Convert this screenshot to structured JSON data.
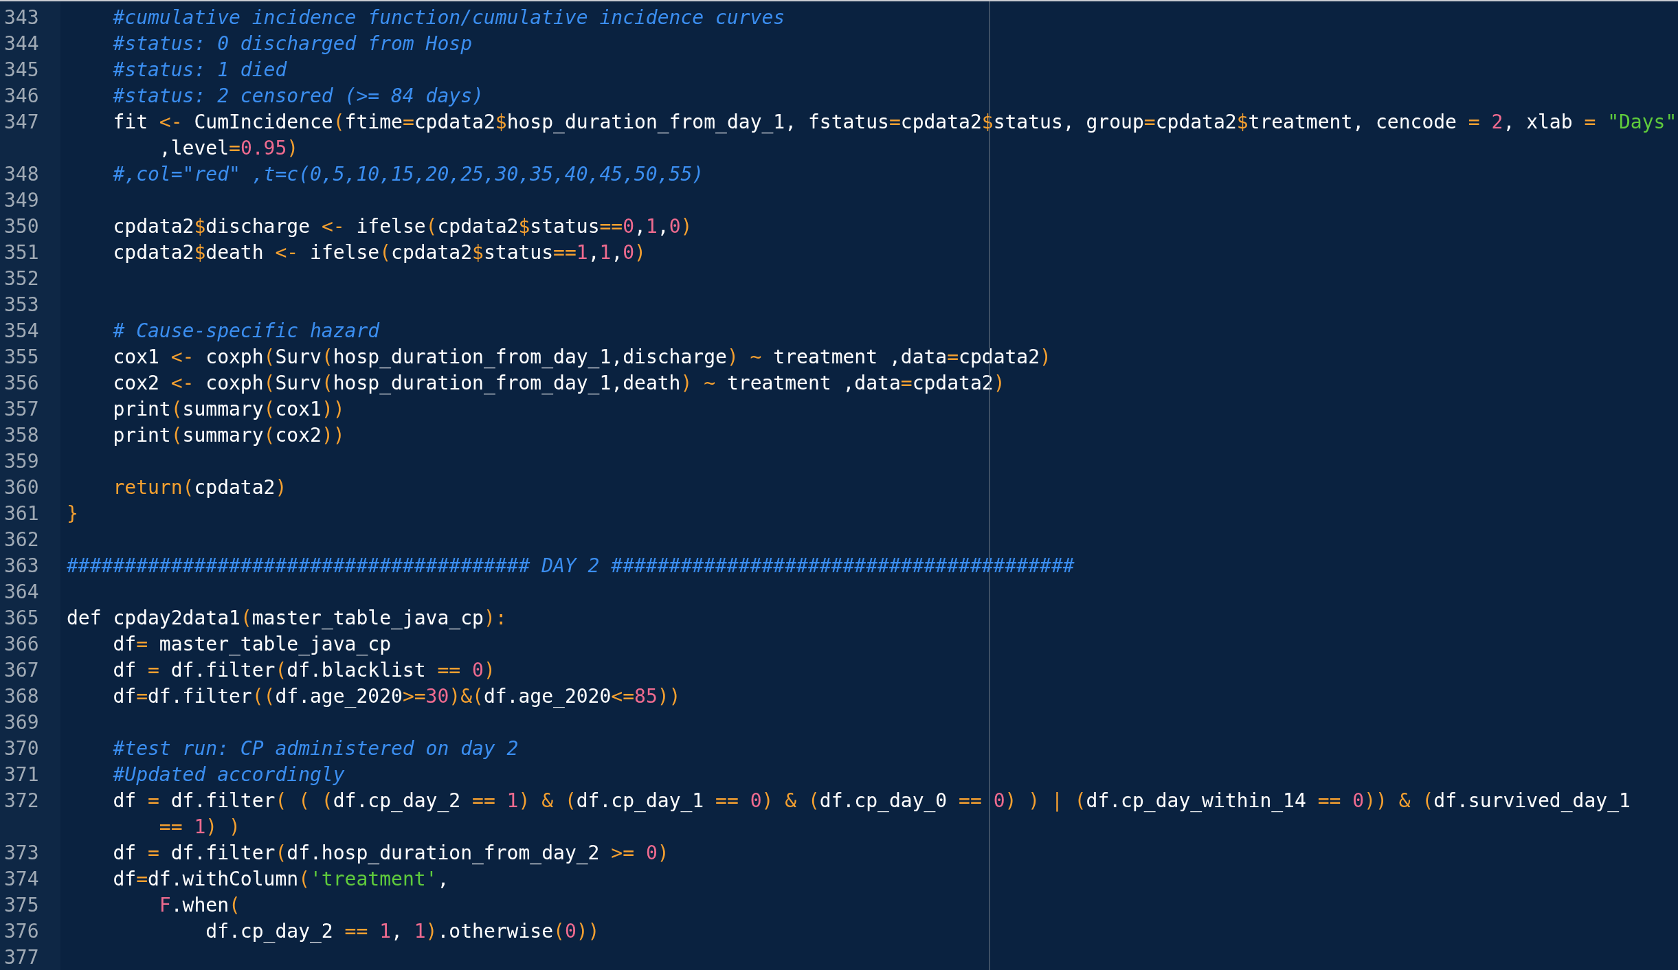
{
  "editor": {
    "lines": [
      {
        "number": "343",
        "segments": [
          {
            "kind": "comment",
            "text": "    #cumulative incidence function/cumulative incidence curves"
          }
        ]
      },
      {
        "number": "344",
        "segments": [
          {
            "kind": "comment",
            "text": "    #status: 0 discharged from Hosp"
          }
        ]
      },
      {
        "number": "345",
        "segments": [
          {
            "kind": "comment",
            "text": "    #status: 1 died"
          }
        ]
      },
      {
        "number": "346",
        "segments": [
          {
            "kind": "comment",
            "text": "    #status: 2 censored (>= 84 days)"
          }
        ]
      },
      {
        "number": "347",
        "segments": [
          {
            "kind": "plain",
            "text": "    fit "
          },
          {
            "kind": "op",
            "text": "<-"
          },
          {
            "kind": "plain",
            "text": " CumIncidence"
          },
          {
            "kind": "op",
            "text": "("
          },
          {
            "kind": "plain",
            "text": "ftime"
          },
          {
            "kind": "op",
            "text": "="
          },
          {
            "kind": "plain",
            "text": "cpdata2"
          },
          {
            "kind": "op",
            "text": "$"
          },
          {
            "kind": "plain",
            "text": "hosp_duration_from_day_1, fstatus"
          },
          {
            "kind": "op",
            "text": "="
          },
          {
            "kind": "plain",
            "text": "cpdata2"
          },
          {
            "kind": "op",
            "text": "$"
          },
          {
            "kind": "plain",
            "text": "status, group"
          },
          {
            "kind": "op",
            "text": "="
          },
          {
            "kind": "plain",
            "text": "cpdata2"
          },
          {
            "kind": "op",
            "text": "$"
          },
          {
            "kind": "plain",
            "text": "treatment, cencode "
          },
          {
            "kind": "op",
            "text": "= "
          },
          {
            "kind": "num",
            "text": "2"
          },
          {
            "kind": "plain",
            "text": ", xlab "
          },
          {
            "kind": "op",
            "text": "= "
          },
          {
            "kind": "str",
            "text": "\"Days\""
          }
        ],
        "wrap": [
          {
            "kind": "plain",
            "text": ",level"
          },
          {
            "kind": "op",
            "text": "="
          },
          {
            "kind": "num",
            "text": "0.95"
          },
          {
            "kind": "op",
            "text": ")"
          }
        ]
      },
      {
        "number": "348",
        "segments": [
          {
            "kind": "comment",
            "text": "    #,col=\"red\" ,t=c(0,5,10,15,20,25,30,35,40,45,50,55)"
          }
        ]
      },
      {
        "number": "349"
      },
      {
        "number": "350",
        "segments": [
          {
            "kind": "plain",
            "text": "    cpdata2"
          },
          {
            "kind": "op",
            "text": "$"
          },
          {
            "kind": "plain",
            "text": "discharge "
          },
          {
            "kind": "op",
            "text": "<-"
          },
          {
            "kind": "plain",
            "text": " ifelse"
          },
          {
            "kind": "op",
            "text": "("
          },
          {
            "kind": "plain",
            "text": "cpdata2"
          },
          {
            "kind": "op",
            "text": "$"
          },
          {
            "kind": "plain",
            "text": "status"
          },
          {
            "kind": "op",
            "text": "=="
          },
          {
            "kind": "num",
            "text": "0"
          },
          {
            "kind": "plain",
            "text": ","
          },
          {
            "kind": "num",
            "text": "1"
          },
          {
            "kind": "plain",
            "text": ","
          },
          {
            "kind": "num",
            "text": "0"
          },
          {
            "kind": "op",
            "text": ")"
          }
        ]
      },
      {
        "number": "351",
        "segments": [
          {
            "kind": "plain",
            "text": "    cpdata2"
          },
          {
            "kind": "op",
            "text": "$"
          },
          {
            "kind": "plain",
            "text": "death "
          },
          {
            "kind": "op",
            "text": "<-"
          },
          {
            "kind": "plain",
            "text": " ifelse"
          },
          {
            "kind": "op",
            "text": "("
          },
          {
            "kind": "plain",
            "text": "cpdata2"
          },
          {
            "kind": "op",
            "text": "$"
          },
          {
            "kind": "plain",
            "text": "status"
          },
          {
            "kind": "op",
            "text": "=="
          },
          {
            "kind": "num",
            "text": "1"
          },
          {
            "kind": "plain",
            "text": ","
          },
          {
            "kind": "num",
            "text": "1"
          },
          {
            "kind": "plain",
            "text": ","
          },
          {
            "kind": "num",
            "text": "0"
          },
          {
            "kind": "op",
            "text": ")"
          }
        ]
      },
      {
        "number": "352"
      },
      {
        "number": "353"
      },
      {
        "number": "354",
        "segments": [
          {
            "kind": "comment",
            "text": "    # Cause-specific hazard"
          }
        ]
      },
      {
        "number": "355",
        "segments": [
          {
            "kind": "plain",
            "text": "    cox1 "
          },
          {
            "kind": "op",
            "text": "<-"
          },
          {
            "kind": "plain",
            "text": " coxph"
          },
          {
            "kind": "op",
            "text": "("
          },
          {
            "kind": "plain",
            "text": "Surv"
          },
          {
            "kind": "op",
            "text": "("
          },
          {
            "kind": "plain",
            "text": "hosp_duration_from_day_1,discharge"
          },
          {
            "kind": "op",
            "text": ") ~"
          },
          {
            "kind": "plain",
            "text": " treatment ,data"
          },
          {
            "kind": "op",
            "text": "="
          },
          {
            "kind": "plain",
            "text": "cpdata2"
          },
          {
            "kind": "op",
            "text": ")"
          }
        ]
      },
      {
        "number": "356",
        "segments": [
          {
            "kind": "plain",
            "text": "    cox2 "
          },
          {
            "kind": "op",
            "text": "<-"
          },
          {
            "kind": "plain",
            "text": " coxph"
          },
          {
            "kind": "op",
            "text": "("
          },
          {
            "kind": "plain",
            "text": "Surv"
          },
          {
            "kind": "op",
            "text": "("
          },
          {
            "kind": "plain",
            "text": "hosp_duration_from_day_1,death"
          },
          {
            "kind": "op",
            "text": ") ~"
          },
          {
            "kind": "plain",
            "text": " treatment ,data"
          },
          {
            "kind": "op",
            "text": "="
          },
          {
            "kind": "plain",
            "text": "cpdata2"
          },
          {
            "kind": "op",
            "text": ")"
          }
        ]
      },
      {
        "number": "357",
        "segments": [
          {
            "kind": "plain",
            "text": "    print"
          },
          {
            "kind": "op",
            "text": "("
          },
          {
            "kind": "plain",
            "text": "summary"
          },
          {
            "kind": "op",
            "text": "("
          },
          {
            "kind": "plain",
            "text": "cox1"
          },
          {
            "kind": "op",
            "text": "))"
          }
        ]
      },
      {
        "number": "358",
        "segments": [
          {
            "kind": "plain",
            "text": "    print"
          },
          {
            "kind": "op",
            "text": "("
          },
          {
            "kind": "plain",
            "text": "summary"
          },
          {
            "kind": "op",
            "text": "("
          },
          {
            "kind": "plain",
            "text": "cox2"
          },
          {
            "kind": "op",
            "text": "))"
          }
        ]
      },
      {
        "number": "359"
      },
      {
        "number": "360",
        "segments": [
          {
            "kind": "op",
            "text": "    return("
          },
          {
            "kind": "plain",
            "text": "cpdata2"
          },
          {
            "kind": "op",
            "text": ")"
          }
        ]
      },
      {
        "number": "361",
        "segments": [
          {
            "kind": "op",
            "text": "}"
          }
        ]
      },
      {
        "number": "362"
      },
      {
        "number": "363",
        "segments": [
          {
            "kind": "comment",
            "text": "######################################## DAY 2 ########################################"
          }
        ]
      },
      {
        "number": "364"
      },
      {
        "number": "365",
        "segments": [
          {
            "kind": "plain",
            "text": "def cpday2data1"
          },
          {
            "kind": "op",
            "text": "("
          },
          {
            "kind": "plain",
            "text": "master_table_java_cp"
          },
          {
            "kind": "op",
            "text": "):"
          }
        ]
      },
      {
        "number": "366",
        "segments": [
          {
            "kind": "plain",
            "text": "    df"
          },
          {
            "kind": "op",
            "text": "="
          },
          {
            "kind": "plain",
            "text": " master_table_java_cp"
          }
        ]
      },
      {
        "number": "367",
        "segments": [
          {
            "kind": "plain",
            "text": "    df "
          },
          {
            "kind": "op",
            "text": "="
          },
          {
            "kind": "plain",
            "text": " df.filter"
          },
          {
            "kind": "op",
            "text": "("
          },
          {
            "kind": "plain",
            "text": "df.blacklist "
          },
          {
            "kind": "op",
            "text": "== "
          },
          {
            "kind": "num",
            "text": "0"
          },
          {
            "kind": "op",
            "text": ")"
          }
        ]
      },
      {
        "number": "368",
        "segments": [
          {
            "kind": "plain",
            "text": "    df"
          },
          {
            "kind": "op",
            "text": "="
          },
          {
            "kind": "plain",
            "text": "df.filter"
          },
          {
            "kind": "op",
            "text": "(("
          },
          {
            "kind": "plain",
            "text": "df.age_2020"
          },
          {
            "kind": "op",
            "text": ">="
          },
          {
            "kind": "num",
            "text": "30"
          },
          {
            "kind": "op",
            "text": ")&("
          },
          {
            "kind": "plain",
            "text": "df.age_2020"
          },
          {
            "kind": "op",
            "text": "<="
          },
          {
            "kind": "num",
            "text": "85"
          },
          {
            "kind": "op",
            "text": "))"
          }
        ]
      },
      {
        "number": "369"
      },
      {
        "number": "370",
        "segments": [
          {
            "kind": "comment",
            "text": "    #test run: CP administered on day 2"
          }
        ]
      },
      {
        "number": "371",
        "segments": [
          {
            "kind": "comment",
            "text": "    #Updated accordingly"
          }
        ]
      },
      {
        "number": "372",
        "segments": [
          {
            "kind": "plain",
            "text": "    df "
          },
          {
            "kind": "op",
            "text": "="
          },
          {
            "kind": "plain",
            "text": " df.filter"
          },
          {
            "kind": "op",
            "text": "( ( ("
          },
          {
            "kind": "plain",
            "text": "df.cp_day_2 "
          },
          {
            "kind": "op",
            "text": "== "
          },
          {
            "kind": "num",
            "text": "1"
          },
          {
            "kind": "op",
            "text": ") & ("
          },
          {
            "kind": "plain",
            "text": "df.cp_day_1 "
          },
          {
            "kind": "op",
            "text": "== "
          },
          {
            "kind": "num",
            "text": "0"
          },
          {
            "kind": "op",
            "text": ") & ("
          },
          {
            "kind": "plain",
            "text": "df.cp_day_0 "
          },
          {
            "kind": "op",
            "text": "== "
          },
          {
            "kind": "num",
            "text": "0"
          },
          {
            "kind": "op",
            "text": ") ) | ("
          },
          {
            "kind": "plain",
            "text": "df.cp_day_within_14 "
          },
          {
            "kind": "op",
            "text": "== "
          },
          {
            "kind": "num",
            "text": "0"
          },
          {
            "kind": "op",
            "text": ")) & ("
          },
          {
            "kind": "plain",
            "text": "df.survived_day_1"
          }
        ],
        "wrap": [
          {
            "kind": "op",
            "text": "== "
          },
          {
            "kind": "num",
            "text": "1"
          },
          {
            "kind": "op",
            "text": ") )"
          }
        ]
      },
      {
        "number": "373",
        "segments": [
          {
            "kind": "plain",
            "text": "    df "
          },
          {
            "kind": "op",
            "text": "="
          },
          {
            "kind": "plain",
            "text": " df.filter"
          },
          {
            "kind": "op",
            "text": "("
          },
          {
            "kind": "plain",
            "text": "df.hosp_duration_from_day_2 "
          },
          {
            "kind": "op",
            "text": ">= "
          },
          {
            "kind": "num",
            "text": "0"
          },
          {
            "kind": "op",
            "text": ")"
          }
        ]
      },
      {
        "number": "374",
        "segments": [
          {
            "kind": "plain",
            "text": "    df"
          },
          {
            "kind": "op",
            "text": "="
          },
          {
            "kind": "plain",
            "text": "df.withColumn"
          },
          {
            "kind": "op",
            "text": "("
          },
          {
            "kind": "str",
            "text": "'treatment'"
          },
          {
            "kind": "plain",
            "text": ","
          }
        ]
      },
      {
        "number": "375",
        "segments": [
          {
            "kind": "num",
            "text": "        F"
          },
          {
            "kind": "plain",
            "text": ".when"
          },
          {
            "kind": "op",
            "text": "("
          }
        ]
      },
      {
        "number": "376",
        "segments": [
          {
            "kind": "plain",
            "text": "            df.cp_day_2 "
          },
          {
            "kind": "op",
            "text": "== "
          },
          {
            "kind": "num",
            "text": "1"
          },
          {
            "kind": "plain",
            "text": ", "
          },
          {
            "kind": "num",
            "text": "1"
          },
          {
            "kind": "op",
            "text": ")"
          },
          {
            "kind": "plain",
            "text": ".otherwise"
          },
          {
            "kind": "op",
            "text": "("
          },
          {
            "kind": "num",
            "text": "0"
          },
          {
            "kind": "op",
            "text": "))"
          }
        ]
      },
      {
        "number": "377"
      }
    ]
  }
}
